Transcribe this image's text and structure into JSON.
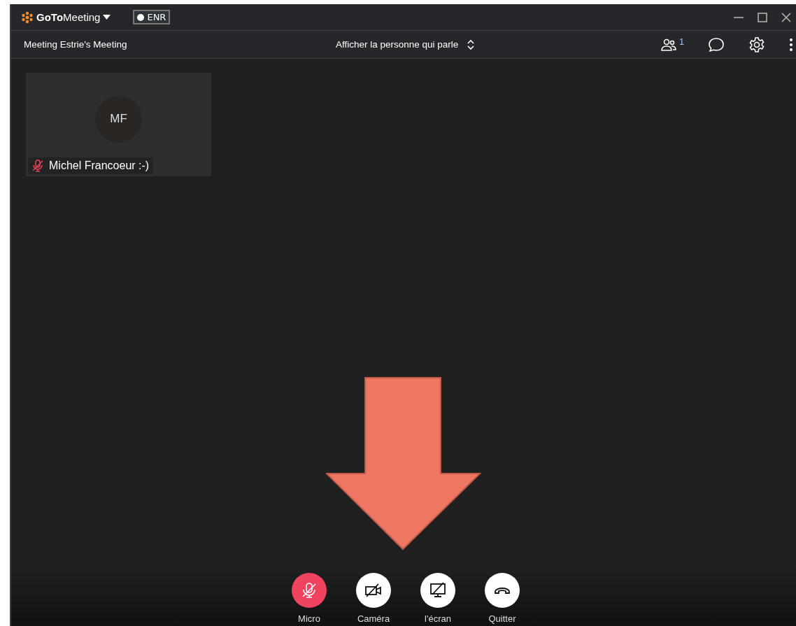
{
  "window": {
    "app_name_bold": "GoTo",
    "app_name": "Meeting",
    "recording_badge": "ENR"
  },
  "toolbar": {
    "meeting_title": "Meeting Estrie's Meeting",
    "view_mode": "Afficher la personne qui parle",
    "participant_count": "1"
  },
  "tiles": [
    {
      "initials": "MF",
      "name": "Michel Francoeur :-)",
      "muted": true
    }
  ],
  "annotation": {
    "kind": "arrow",
    "color": "#ee7763"
  },
  "controls": [
    {
      "kind": "mic",
      "label": "Micro",
      "highlighted": true
    },
    {
      "kind": "camera",
      "label": "Caméra",
      "highlighted": false
    },
    {
      "kind": "screen",
      "label": "l'écran",
      "highlighted": false
    },
    {
      "kind": "leave",
      "label": "Quitter",
      "highlighted": false
    }
  ]
}
